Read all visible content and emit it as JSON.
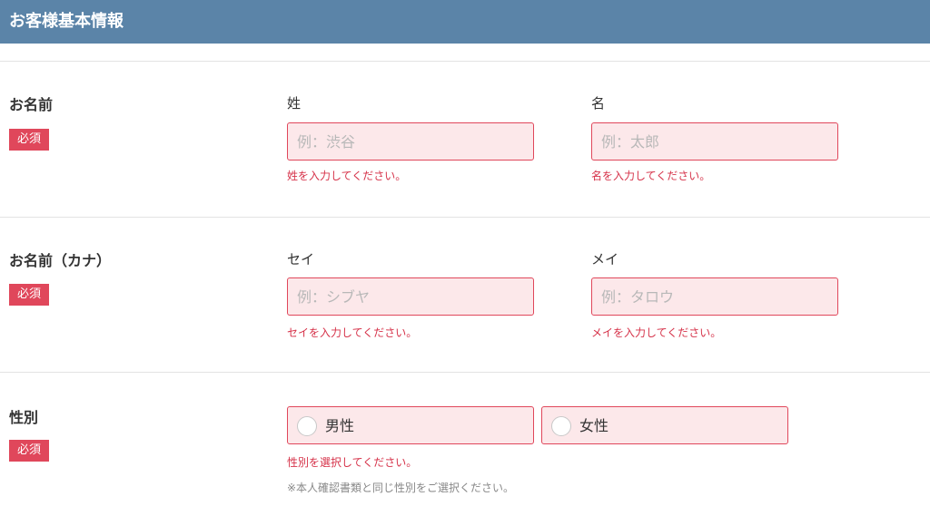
{
  "header": {
    "title": "お客様基本情報"
  },
  "required_badge": "必須",
  "name": {
    "label": "お名前",
    "last": {
      "label": "姓",
      "placeholder": "例：渋谷",
      "error": "姓を入力してください。"
    },
    "first": {
      "label": "名",
      "placeholder": "例：太郎",
      "error": "名を入力してください。"
    }
  },
  "kana": {
    "label": "お名前（カナ）",
    "last": {
      "label": "セイ",
      "placeholder": "例：シブヤ",
      "error": "セイを入力してください。"
    },
    "first": {
      "label": "メイ",
      "placeholder": "例：タロウ",
      "error": "メイを入力してください。"
    }
  },
  "gender": {
    "label": "性別",
    "options": [
      "男性",
      "女性"
    ],
    "error": "性別を選択してください。",
    "note": "※本人確認書類と同じ性別をご選択ください。"
  },
  "colors": {
    "header": "#5b84a8",
    "required": "#e0475b",
    "error_text": "#d6334a",
    "input_bg": "#fce8ea"
  }
}
